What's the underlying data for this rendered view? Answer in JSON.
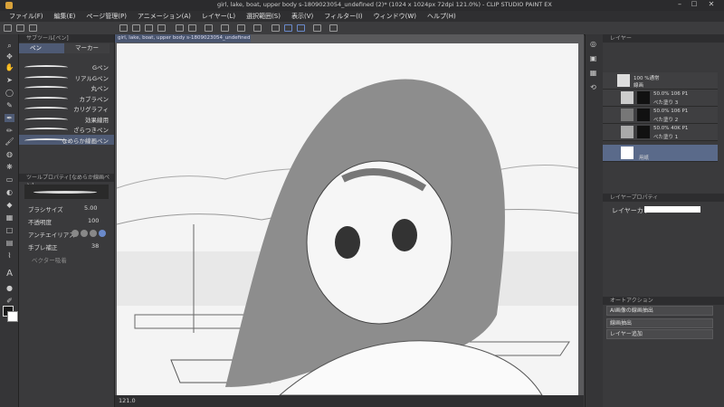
{
  "app": {
    "title": "girl, lake, boat, upper body s-1809023054_undefined (2)* (1024 x 1024px 72dpi 121.0%)  - CLIP STUDIO PAINT EX"
  },
  "menu": [
    "ファイル(F)",
    "編集(E)",
    "ページ管理(P)",
    "アニメーション(A)",
    "レイヤー(L)",
    "選択範囲(S)",
    "表示(V)",
    "フィルター(I)",
    "ウィンドウ(W)",
    "ヘルプ(H)"
  ],
  "subtool": {
    "panel_title": "サブツール[ペン]",
    "tabs": [
      "ペン",
      "マーカー"
    ],
    "brushes": [
      "Gペン",
      "リアルGペン",
      "丸ペン",
      "カブラペン",
      "カリグラフィ",
      "効果線用",
      "ざらつきペン",
      "なめらか線画ペン"
    ]
  },
  "toolprop": {
    "title": "ツールプロパティ[なめらか線画ペン]",
    "brush_size_label": "ブラシサイズ",
    "brush_size_value": "5.00",
    "opacity_label": "不透明度",
    "opacity_value": "100",
    "antialias_label": "アンチエイリアス",
    "stabilization_label": "手ブレ補正",
    "stabilization_value": "38",
    "vector_label": "ベクター吸着"
  },
  "document": {
    "tab_label": "girl, lake, boat, upper body s-1809023054_undefined (2)*"
  },
  "status": {
    "zoom": "121.0"
  },
  "layers": {
    "panel_title": "レイヤー",
    "items": [
      {
        "name": "100 %通常",
        "sub": "線画"
      },
      {
        "name": "50.0% 106 P1",
        "sub": "べた塗り 3"
      },
      {
        "name": "50.0% 106 P1",
        "sub": "べた塗り 2"
      },
      {
        "name": "50.0% 40K P1",
        "sub": "べた塗り 1"
      },
      {
        "name": "",
        "sub": "用紙"
      }
    ]
  },
  "layerprop": {
    "title": "レイヤープロパティ",
    "layer_color_label": "レイヤーカラー"
  },
  "autoaction": {
    "title": "オートアクション",
    "selected": "AI画像の線画抽出",
    "actions": [
      "線画抽出",
      "レイヤー追加"
    ]
  }
}
